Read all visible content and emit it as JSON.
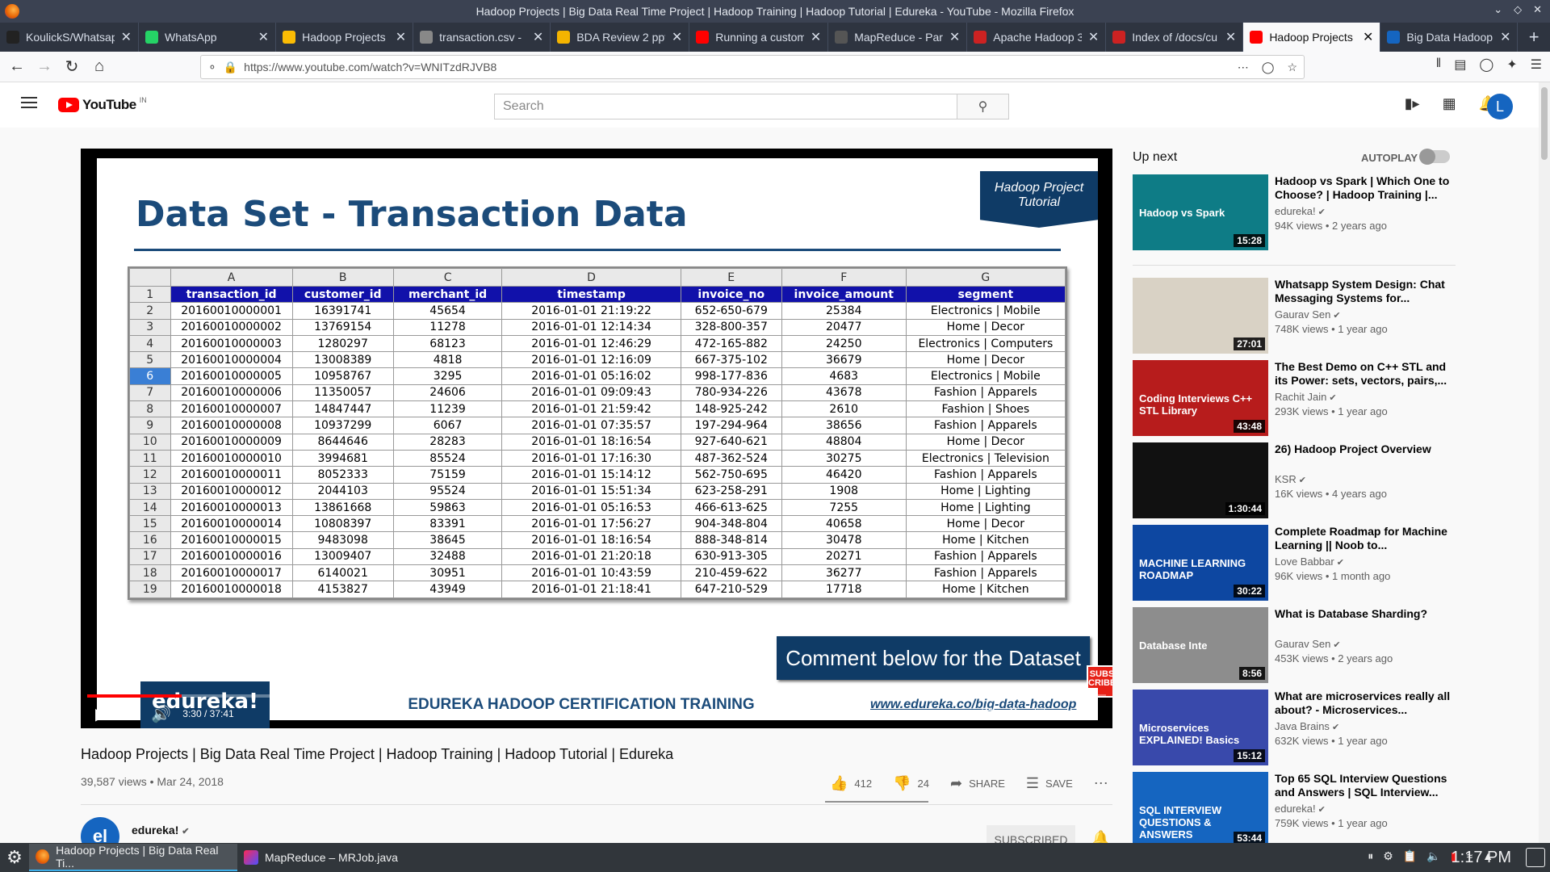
{
  "window": {
    "title": "Hadoop Projects | Big Data Real Time Project | Hadoop Training | Hadoop Tutorial | Edureka - YouTube - Mozilla Firefox"
  },
  "tabs": [
    {
      "label": "KoulickS/Whatsap",
      "color": "#222222"
    },
    {
      "label": "WhatsApp",
      "color": "#25d366"
    },
    {
      "label": "Hadoop Projects",
      "color": "#fbbc04"
    },
    {
      "label": "transaction.csv - ",
      "color": "#888888"
    },
    {
      "label": "BDA Review 2 ppt",
      "color": "#f4b400"
    },
    {
      "label": "Running a custom",
      "color": "#ff0000"
    },
    {
      "label": "MapReduce - Par",
      "color": "#555555"
    },
    {
      "label": "Apache Hadoop 3",
      "color": "#cc2222"
    },
    {
      "label": "Index of /docs/cu",
      "color": "#cc2222"
    },
    {
      "label": "Hadoop Projects",
      "color": "#ff0000"
    },
    {
      "label": "Big Data Hadoop",
      "color": "#1565c0"
    }
  ],
  "active_tab_index": 9,
  "url": "https://www.youtube.com/watch?v=WNITzdRJVB8",
  "youtube": {
    "logo_text": "YouTube",
    "country": "IN",
    "search_placeholder": "Search",
    "avatar_letter": "L"
  },
  "slide": {
    "title": "Data Set - Transaction Data",
    "badge": "Hadoop Project Tutorial",
    "cta": "Comment below for the Dataset",
    "subscribe": "SUBS CRIBE",
    "banner": "EDUREKA HADOOP CERTIFICATION TRAINING",
    "banner_url": "www.edureka.co/big-data-hadoop",
    "logo": "edureka!",
    "col_letters": [
      "A",
      "B",
      "C",
      "D",
      "E",
      "F",
      "G"
    ],
    "headers": [
      "transaction_id",
      "customer_id",
      "merchant_id",
      "timestamp",
      "invoice_no",
      "invoice_amount",
      "segment"
    ],
    "selected_row": 6,
    "rows": [
      [
        "20160010000001",
        "16391741",
        "45654",
        "2016-01-01 21:19:22",
        "652-650-679",
        "25384",
        "Electronics | Mobile"
      ],
      [
        "20160010000002",
        "13769154",
        "11278",
        "2016-01-01 12:14:34",
        "328-800-357",
        "20477",
        "Home | Decor"
      ],
      [
        "20160010000003",
        "1280297",
        "68123",
        "2016-01-01 12:46:29",
        "472-165-882",
        "24250",
        "Electronics | Computers"
      ],
      [
        "20160010000004",
        "13008389",
        "4818",
        "2016-01-01 12:16:09",
        "667-375-102",
        "36679",
        "Home | Decor"
      ],
      [
        "20160010000005",
        "10958767",
        "3295",
        "2016-01-01 05:16:02",
        "998-177-836",
        "4683",
        "Electronics | Mobile"
      ],
      [
        "20160010000006",
        "11350057",
        "24606",
        "2016-01-01 09:09:43",
        "780-934-226",
        "43678",
        "Fashion | Apparels"
      ],
      [
        "20160010000007",
        "14847447",
        "11239",
        "2016-01-01 21:59:42",
        "148-925-242",
        "2610",
        "Fashion | Shoes"
      ],
      [
        "20160010000008",
        "10937299",
        "6067",
        "2016-01-01 07:35:57",
        "197-294-964",
        "38656",
        "Fashion | Apparels"
      ],
      [
        "20160010000009",
        "8644646",
        "28283",
        "2016-01-01 18:16:54",
        "927-640-621",
        "48804",
        "Home | Decor"
      ],
      [
        "20160010000010",
        "3994681",
        "85524",
        "2016-01-01 17:16:30",
        "487-362-524",
        "30275",
        "Electronics | Television"
      ],
      [
        "20160010000011",
        "8052333",
        "75159",
        "2016-01-01 15:14:12",
        "562-750-695",
        "46420",
        "Fashion | Apparels"
      ],
      [
        "20160010000012",
        "2044103",
        "95524",
        "2016-01-01 15:51:34",
        "623-258-291",
        "1908",
        "Home | Lighting"
      ],
      [
        "20160010000013",
        "13861668",
        "59863",
        "2016-01-01 05:16:53",
        "466-613-625",
        "7255",
        "Home | Lighting"
      ],
      [
        "20160010000014",
        "10808397",
        "83391",
        "2016-01-01 17:56:27",
        "904-348-804",
        "40658",
        "Home | Decor"
      ],
      [
        "20160010000015",
        "9483098",
        "38645",
        "2016-01-01 18:16:54",
        "888-348-814",
        "30478",
        "Home | Kitchen"
      ],
      [
        "20160010000016",
        "13009407",
        "32488",
        "2016-01-01 21:20:18",
        "630-913-305",
        "20271",
        "Fashion | Apparels"
      ],
      [
        "20160010000017",
        "6140021",
        "30951",
        "2016-01-01 10:43:59",
        "210-459-622",
        "36277",
        "Fashion | Apparels"
      ],
      [
        "20160010000018",
        "4153827",
        "43949",
        "2016-01-01 21:18:41",
        "647-210-529",
        "17718",
        "Home | Kitchen"
      ]
    ]
  },
  "player": {
    "time": "3:30 / 37:41",
    "progress_fraction": 0.093
  },
  "video": {
    "title": "Hadoop Projects | Big Data Real Time Project | Hadoop Training | Hadoop Tutorial | Edureka",
    "meta": "39,587 views • Mar 24, 2018",
    "likes": "412",
    "dislikes": "24",
    "share": "SHARE",
    "save": "SAVE",
    "channel": "edureka!",
    "channel_avatar": "el",
    "subscribed": "SUBSCRIBED"
  },
  "sidebar": {
    "up_next": "Up next",
    "autoplay": "AUTOPLAY",
    "items": [
      {
        "title": "Hadoop vs Spark | Which One to Choose? | Hadoop Training |...",
        "channel": "edureka!",
        "views": "94K views • 2 years ago",
        "duration": "15:28",
        "thumb_text": "Hadoop vs Spark",
        "thumb_color": "#0e7c86"
      },
      {
        "title": "Whatsapp System Design: Chat Messaging Systems for...",
        "channel": "Gaurav Sen",
        "views": "748K views • 1 year ago",
        "duration": "27:01",
        "thumb_text": "",
        "thumb_color": "#d9d2c5"
      },
      {
        "title": "The Best Demo on C++ STL and its Power: sets, vectors, pairs,...",
        "channel": "Rachit Jain",
        "views": "293K views • 1 year ago",
        "duration": "43:48",
        "thumb_text": "Coding Interviews C++ STL Library",
        "thumb_color": "#b71c1c"
      },
      {
        "title": "26) Hadoop Project Overview",
        "channel": "KSR",
        "views": "16K views • 4 years ago",
        "duration": "1:30:44",
        "thumb_text": "",
        "thumb_color": "#111111"
      },
      {
        "title": "Complete Roadmap for Machine Learning || Noob to...",
        "channel": "Love Babbar",
        "views": "96K views • 1 month ago",
        "duration": "30:22",
        "thumb_text": "MACHINE LEARNING ROADMAP",
        "thumb_color": "#0d47a1"
      },
      {
        "title": "What is Database Sharding?",
        "channel": "Gaurav Sen",
        "views": "453K views • 2 years ago",
        "duration": "8:56",
        "thumb_text": "Database Inte",
        "thumb_color": "#8d8d8d"
      },
      {
        "title": "What are microservices really all about? - Microservices...",
        "channel": "Java Brains",
        "views": "632K views • 1 year ago",
        "duration": "15:12",
        "thumb_text": "Microservices EXPLAINED! Basics",
        "thumb_color": "#3949ab"
      },
      {
        "title": "Top 65 SQL Interview Questions and Answers | SQL Interview...",
        "channel": "edureka!",
        "views": "759K views • 1 year ago",
        "duration": "53:44",
        "thumb_text": "SQL INTERVIEW QUESTIONS & ANSWERS",
        "thumb_color": "#1565c0"
      }
    ]
  },
  "taskbar": {
    "tasks": [
      "Hadoop Projects | Big Data Real Ti...",
      "MapReduce – MRJob.java"
    ],
    "clock": "1:17 PM"
  }
}
